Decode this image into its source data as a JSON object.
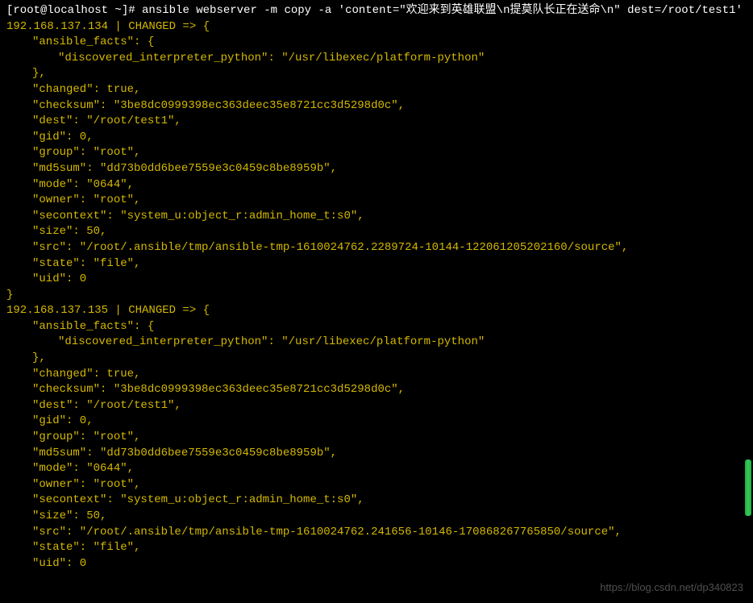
{
  "prompt": {
    "user_host": "[root@localhost ~]# ",
    "command": "ansible webserver -m copy -a 'content=\"欢迎来到英雄联盟\\n提莫队长正在送命\\n\" dest=/root/test1'"
  },
  "hosts": [
    {
      "header": "192.168.137.134 | CHANGED => {",
      "lines": [
        {
          "indent": 1,
          "text": "\"ansible_facts\": {"
        },
        {
          "indent": 2,
          "text": "\"discovered_interpreter_python\": \"/usr/libexec/platform-python\""
        },
        {
          "indent": 1,
          "text": "},"
        },
        {
          "indent": 1,
          "text": "\"changed\": true,"
        },
        {
          "indent": 1,
          "text": "\"checksum\": \"3be8dc0999398ec363deec35e8721cc3d5298d0c\","
        },
        {
          "indent": 1,
          "text": "\"dest\": \"/root/test1\","
        },
        {
          "indent": 1,
          "text": "\"gid\": 0,"
        },
        {
          "indent": 1,
          "text": "\"group\": \"root\","
        },
        {
          "indent": 1,
          "text": "\"md5sum\": \"dd73b0dd6bee7559e3c0459c8be8959b\","
        },
        {
          "indent": 1,
          "text": "\"mode\": \"0644\","
        },
        {
          "indent": 1,
          "text": "\"owner\": \"root\","
        },
        {
          "indent": 1,
          "text": "\"secontext\": \"system_u:object_r:admin_home_t:s0\","
        },
        {
          "indent": 1,
          "text": "\"size\": 50,"
        },
        {
          "indent": 1,
          "text": "\"src\": \"/root/.ansible/tmp/ansible-tmp-1610024762.2289724-10144-122061205202160/source\","
        },
        {
          "indent": 1,
          "text": "\"state\": \"file\","
        },
        {
          "indent": 1,
          "text": "\"uid\": 0"
        }
      ],
      "close": "}"
    },
    {
      "header": "192.168.137.135 | CHANGED => {",
      "lines": [
        {
          "indent": 1,
          "text": "\"ansible_facts\": {"
        },
        {
          "indent": 2,
          "text": "\"discovered_interpreter_python\": \"/usr/libexec/platform-python\""
        },
        {
          "indent": 1,
          "text": "},"
        },
        {
          "indent": 1,
          "text": "\"changed\": true,"
        },
        {
          "indent": 1,
          "text": "\"checksum\": \"3be8dc0999398ec363deec35e8721cc3d5298d0c\","
        },
        {
          "indent": 1,
          "text": "\"dest\": \"/root/test1\","
        },
        {
          "indent": 1,
          "text": "\"gid\": 0,"
        },
        {
          "indent": 1,
          "text": "\"group\": \"root\","
        },
        {
          "indent": 1,
          "text": "\"md5sum\": \"dd73b0dd6bee7559e3c0459c8be8959b\","
        },
        {
          "indent": 1,
          "text": "\"mode\": \"0644\","
        },
        {
          "indent": 1,
          "text": "\"owner\": \"root\","
        },
        {
          "indent": 1,
          "text": "\"secontext\": \"system_u:object_r:admin_home_t:s0\","
        },
        {
          "indent": 1,
          "text": "\"size\": 50,"
        },
        {
          "indent": 1,
          "text": "\"src\": \"/root/.ansible/tmp/ansible-tmp-1610024762.241656-10146-170868267765850/source\","
        },
        {
          "indent": 1,
          "text": "\"state\": \"file\","
        },
        {
          "indent": 1,
          "text": "\"uid\": 0"
        }
      ],
      "close": ""
    }
  ],
  "watermark": "https://blog.csdn.net/dp340823"
}
